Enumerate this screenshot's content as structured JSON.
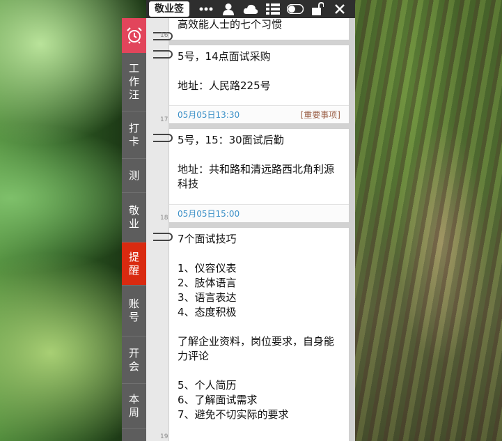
{
  "app": {
    "name": "敬业签"
  },
  "toolbar": {
    "icons": [
      "more-icon",
      "user-icon",
      "cloud-icon",
      "list-icon",
      "toggle-icon",
      "lock-icon",
      "close-icon"
    ]
  },
  "sidebar": {
    "items": [
      {
        "label": "工\n作\n汪",
        "active": false
      },
      {
        "label": "打\n卡",
        "active": false
      },
      {
        "label": "测",
        "active": false
      },
      {
        "label": "敬\n业",
        "active": false
      },
      {
        "label": "提\n醒",
        "active": true
      },
      {
        "label": "账\n号",
        "active": false
      },
      {
        "label": "开\n会",
        "active": false
      },
      {
        "label": "本\n周",
        "active": false
      }
    ]
  },
  "notes": [
    {
      "number": "16",
      "text": "高效能人士的七个习惯",
      "date": "",
      "tag": ""
    },
    {
      "number": "17",
      "text": "5号，14点面试采购\n\n地址：人民路225号",
      "date": "05月05日13:30",
      "tag": "[重要事项]"
    },
    {
      "number": "18",
      "text": "5号，15：30面试后勤\n\n地址：共和路和清远路西北角利源科技",
      "date": "05月05日15:00",
      "tag": ""
    },
    {
      "number": "19",
      "text": "7个面试技巧\n\n1、仪容仪表\n2、肢体语言\n3、语言表达\n4、态度积极\n\n了解企业资料，岗位要求，自身能力评论\n\n5、个人简历\n6、了解面试需求\n7、避免不切实际的要求",
      "date": "",
      "tag": ""
    }
  ],
  "colors": {
    "alarm": "#e2455b",
    "active": "#d92a10",
    "date": "#3a8fc7",
    "tag": "#9a5e45"
  }
}
